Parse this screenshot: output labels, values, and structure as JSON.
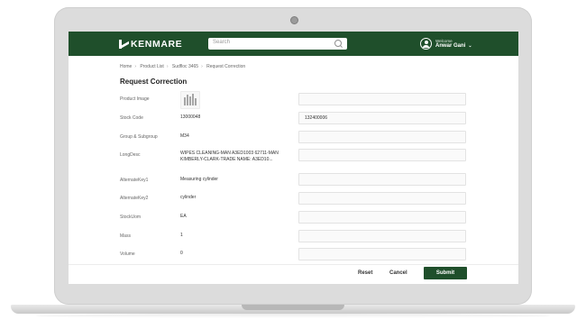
{
  "header": {
    "brand": "KENMARE",
    "search_placeholder": "Search",
    "welcome": "Welcome",
    "user_name": "Anwar Gani"
  },
  "breadcrumb": [
    "Home",
    "Product List",
    "Sudfloc 3465",
    "Request Correction"
  ],
  "page_title": "Request Correction",
  "fields": [
    {
      "label": "Product Image",
      "value": "",
      "edit_value": ""
    },
    {
      "label": "Stock Code",
      "value": "13000048",
      "edit_value": "132400006"
    },
    {
      "label": "Group & Subgroup",
      "value": "M34",
      "edit_value": ""
    },
    {
      "label": "LongDesc",
      "value": "WIPES CLEANING-MAN A3ED1003 62711-MAN KIMBERLY-CLARK-TRADE NAME: A3ED10...",
      "edit_value": ""
    },
    {
      "label": "AlternateKey1",
      "value": "Measuring cylinder",
      "edit_value": ""
    },
    {
      "label": "AlternateKey2",
      "value": "cylinder",
      "edit_value": ""
    },
    {
      "label": "StockUom",
      "value": "EA",
      "edit_value": ""
    },
    {
      "label": "Mass",
      "value": "1",
      "edit_value": ""
    },
    {
      "label": "Volume",
      "value": "0",
      "edit_value": ""
    }
  ],
  "actions": {
    "reset": "Reset",
    "cancel": "Cancel",
    "submit": "Submit"
  },
  "colors": {
    "brand_green": "#1f4f2b"
  }
}
